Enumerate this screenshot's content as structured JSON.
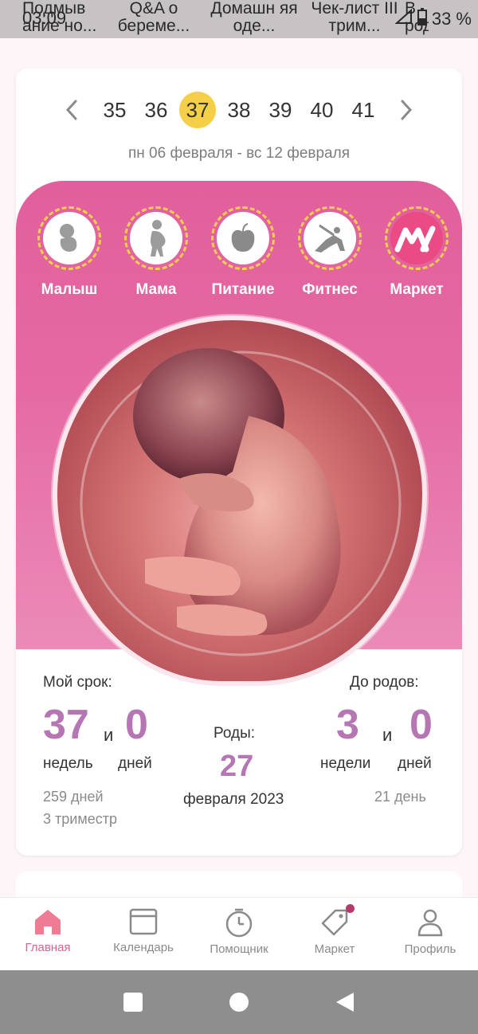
{
  "status_bar": {
    "time": "03:09",
    "battery": "33 %",
    "tabs_behind": [
      "Подмыв ание но...",
      "Q&A о береме...",
      "Домашн яя оде...",
      "Чек-лист III трим...",
      "В роддо"
    ]
  },
  "weeks": {
    "items": [
      "35",
      "36",
      "37",
      "38",
      "39",
      "40",
      "41"
    ],
    "selected": "37",
    "range": "пн 06 февраля - вс 12 февраля"
  },
  "categories": [
    "Малыш",
    "Мама",
    "Питание",
    "Фитнес",
    "Маркет"
  ],
  "stats": {
    "my_term_label": "Мой срок:",
    "weeks": "37",
    "and1": "и",
    "days": "0",
    "weeks_unit": "недель",
    "days_unit": "дней",
    "total_days": "259 дней",
    "trimester": "3 триместр",
    "birth_label": "Роды:",
    "birth_day": "27",
    "birth_month_year": "февраля 2023",
    "until_label": "До родов:",
    "remain_weeks": "3",
    "and2": "и",
    "remain_days": "0",
    "remain_weeks_unit": "недели",
    "remain_days_unit": "дней",
    "remain_total": "21 день"
  },
  "bottom_nav": [
    "Главная",
    "Календарь",
    "Помощник",
    "Маркет",
    "Профиль"
  ],
  "colors": {
    "accent_pink": "#e15f9c",
    "selected_week": "#f6cf49",
    "number_purple": "#b576b3"
  }
}
